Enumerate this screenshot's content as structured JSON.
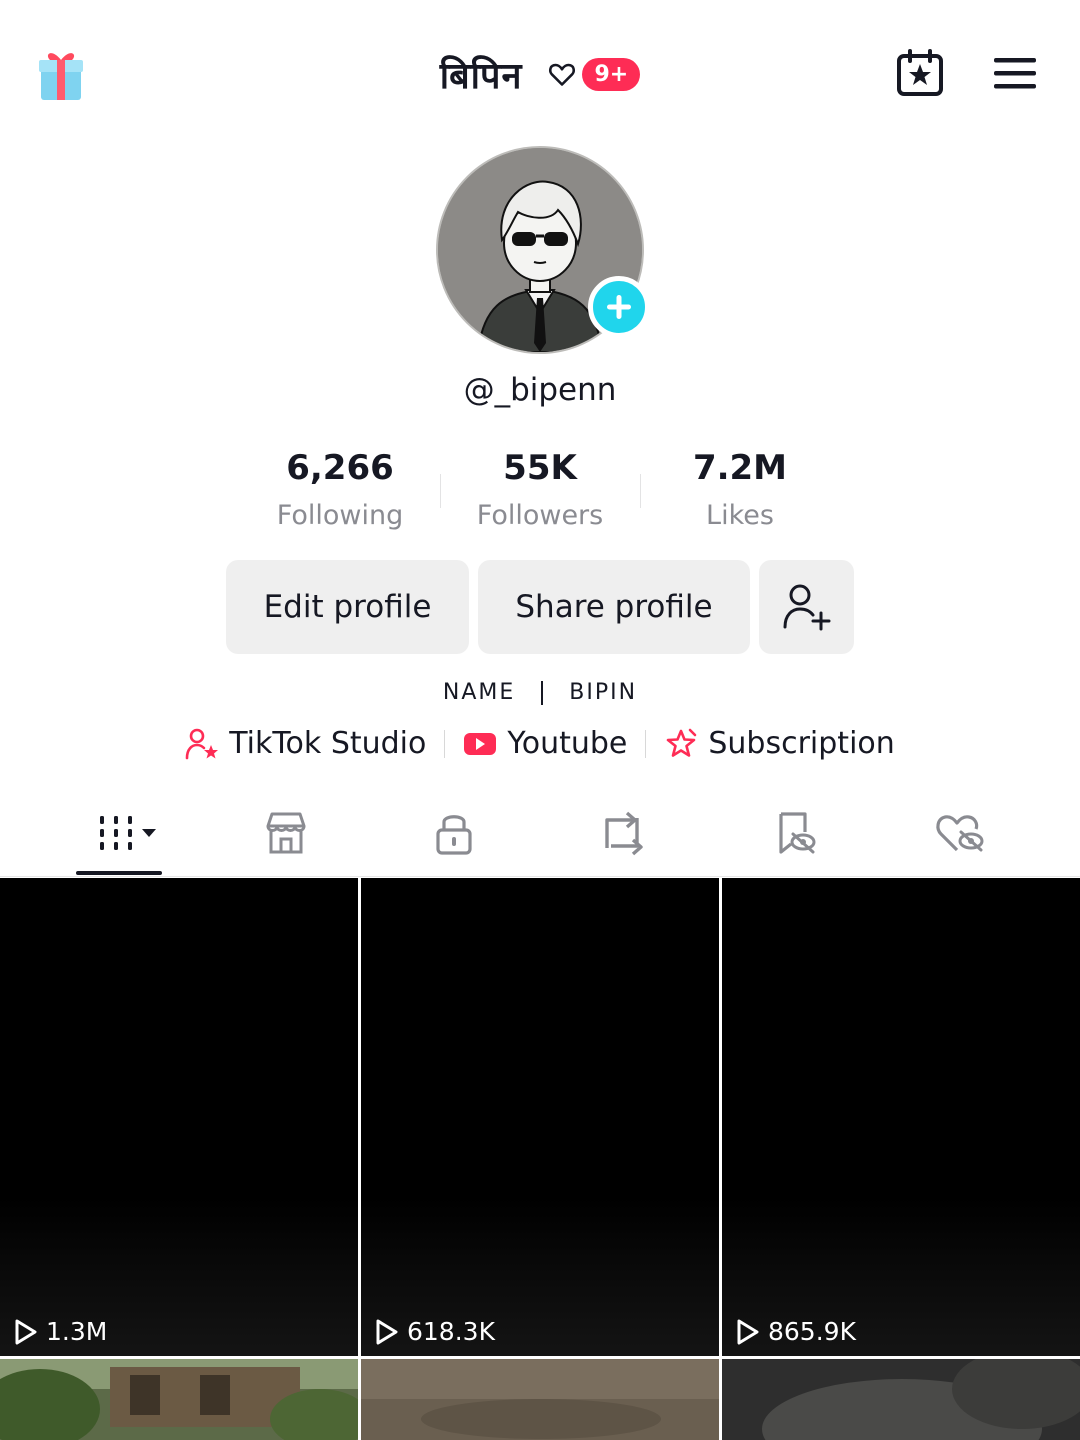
{
  "header": {
    "title": "बिपिन",
    "notification_badge": "9+",
    "icons": [
      "gift-icon",
      "heart-outline-icon",
      "calendar-star-icon",
      "menu-icon"
    ]
  },
  "profile": {
    "handle": "@_bipenn",
    "stats": [
      {
        "value": "6,266",
        "label": "Following"
      },
      {
        "value": "55K",
        "label": "Followers"
      },
      {
        "value": "7.2M",
        "label": "Likes"
      }
    ],
    "buttons": {
      "edit": "Edit profile",
      "share": "Share profile"
    },
    "bio": {
      "left": "NAME",
      "right": "BIPIN"
    },
    "links": [
      {
        "label": "TikTok Studio",
        "icon": "person-star-icon"
      },
      {
        "label": "Youtube",
        "icon": "youtube-icon"
      },
      {
        "label": "Subscription",
        "icon": "subscription-star-icon"
      }
    ]
  },
  "tabs": [
    "videos-tab",
    "shop-tab",
    "private-tab",
    "reposts-tab",
    "favorites-tab",
    "liked-tab"
  ],
  "videos": [
    {
      "views": "1.3M"
    },
    {
      "views": "618.3K"
    },
    {
      "views": "865.9K"
    }
  ],
  "colors": {
    "accent": "#fe2c55",
    "avatar_plus": "#20d5ec",
    "text": "#161823",
    "muted": "#8a8b91"
  }
}
